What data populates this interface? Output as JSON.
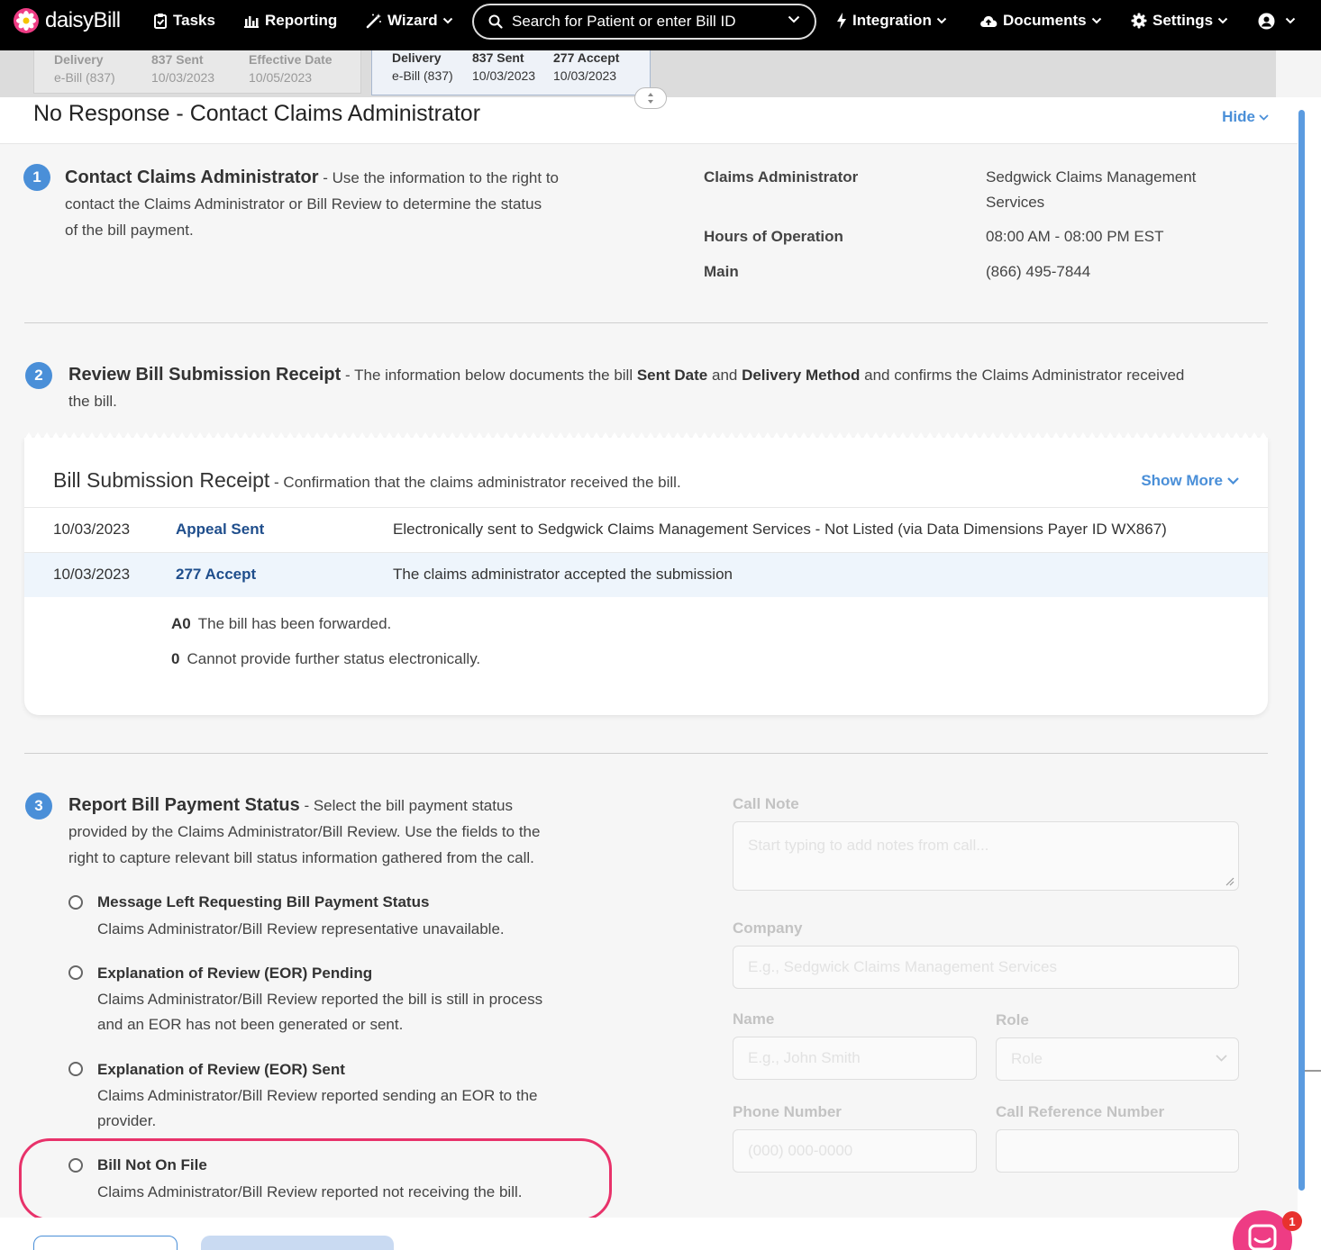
{
  "nav": {
    "brand": "daisyBill",
    "tasks": "Tasks",
    "reporting": "Reporting",
    "wizard": "Wizard",
    "search_placeholder": "Search for Patient or enter Bill ID",
    "integration": "Integration",
    "documents": "Documents",
    "settings": "Settings"
  },
  "history": {
    "previous": {
      "delivery_label": "Delivery",
      "delivery_value": "e-Bill (837)",
      "sent_label": "837 Sent",
      "sent_value": "10/03/2023",
      "effective_label": "Effective Date",
      "effective_value": "10/05/2023"
    },
    "current": {
      "delivery_label": "Delivery",
      "delivery_value": "e-Bill (837)",
      "sent_label": "837 Sent",
      "sent_value": "10/03/2023",
      "accept_label": "277 Accept",
      "accept_value": "10/03/2023"
    }
  },
  "panel": {
    "title": "No Response - Contact Claims Administrator",
    "hide": "Hide"
  },
  "step1": {
    "number": "1",
    "heading": "Contact Claims Administrator",
    "text_line1": " - Use the information to the right to",
    "text_line2": "contact the Claims Administrator or Bill Review to determine the status",
    "text_line3": "of the bill payment.",
    "details": [
      {
        "label": "Claims Administrator",
        "value_line1": "Sedgwick Claims Management",
        "value_line2": "Services"
      },
      {
        "label": "Hours of Operation",
        "value_line1": "08:00 AM - 08:00 PM EST"
      },
      {
        "label": "Main",
        "value_line1": "(866) 495-7844"
      }
    ]
  },
  "step2": {
    "number": "2",
    "heading": "Review Bill Submission Receipt",
    "t1": " - The information below documents the bill ",
    "b1": "Sent Date",
    "t2": " and ",
    "b2": "Delivery Method",
    "t3": " and confirms the Claims Administrator received",
    "t4": "the bill."
  },
  "receipt": {
    "heading": "Bill Submission Receipt",
    "subheading": " - Confirmation that the claims administrator received the bill.",
    "show_more": "Show More",
    "rows": [
      {
        "date": "10/03/2023",
        "event": "Appeal Sent",
        "message": "Electronically sent to Sedgwick Claims Management Services - Not Listed (via Data Dimensions Payer ID WX867)"
      },
      {
        "date": "10/03/2023",
        "event": "277 Accept",
        "message": "The claims administrator accepted the submission"
      }
    ],
    "codes": [
      {
        "code": "A0",
        "text": "The bill has been forwarded."
      },
      {
        "code": "0",
        "text": "Cannot provide further status electronically."
      }
    ]
  },
  "step3": {
    "number": "3",
    "heading": "Report Bill Payment Status",
    "line1": " - Select the bill payment status",
    "line2": "provided by the Claims Administrator/Bill Review. Use the fields to the",
    "line3": "right to capture relevant bill status information gathered from the call.",
    "options": [
      {
        "title": "Message Left Requesting Bill Payment Status",
        "desc1": "Claims Administrator/Bill Review representative unavailable."
      },
      {
        "title": "Explanation of Review (EOR) Pending",
        "desc1": "Claims Administrator/Bill Review reported the bill is still in process",
        "desc2": "and an EOR has not been generated or sent."
      },
      {
        "title": "Explanation of Review (EOR) Sent",
        "desc1": "Claims Administrator/Bill Review reported sending an EOR to the",
        "desc2": "provider."
      },
      {
        "title": "Bill Not On File",
        "desc1": "Claims Administrator/Bill Review reported not receiving the bill."
      }
    ]
  },
  "form": {
    "call_note_label": "Call Note",
    "call_note_placeholder": "Start typing to add notes from call...",
    "company_label": "Company",
    "company_placeholder": "E.g., Sedgwick Claims Management Services",
    "name_label": "Name",
    "name_placeholder": "E.g., John Smith",
    "role_label": "Role",
    "role_value": "Role",
    "phone_label": "Phone Number",
    "phone_placeholder": "(000) 000-0000",
    "ref_label": "Call Reference Number"
  },
  "chat": {
    "badge": "1"
  },
  "colors": {
    "accent": "#4a8fd8",
    "highlight": "#e8326a",
    "nav_bg": "#000000",
    "event_link": "#1f4e8c"
  }
}
